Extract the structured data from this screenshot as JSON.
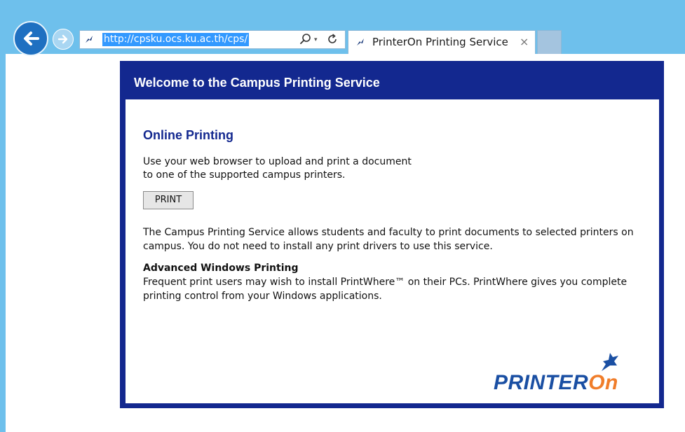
{
  "browser": {
    "address_url": "http://cpsku.ocs.ku.ac.th/cps/",
    "dropdown_glyph": "▾",
    "tab_title": "PrinterOn Printing Service",
    "tab_close": "×",
    "icons": [
      "back-arrow-icon",
      "forward-arrow-icon",
      "site-favicon-icon",
      "search-icon",
      "refresh-icon",
      "close-icon"
    ]
  },
  "page": {
    "header": "Welcome to the Campus Printing Service",
    "section_title": "Online Printing",
    "intro_text": "Use your web browser to upload and print a document to one of the supported campus printers.",
    "print_button": "PRINT",
    "description": "The Campus Printing Service allows students and faculty to print documents to selected printers on campus. You do not need to install any print drivers to use this service.",
    "advanced_title": "Advanced Windows Printing",
    "advanced_text": "Frequent print users may wish to install PrintWhere™ on their PCs. PrintWhere gives you complete printing control from your Windows applications.",
    "logo_part1": "PRINTER",
    "logo_part2": "On"
  },
  "colors": {
    "chrome": "#6ec0ec",
    "panel_navy": "#13288f",
    "logo_blue": "#1a4fa3",
    "logo_orange": "#f07d2a",
    "url_highlight": "#3399ff"
  }
}
